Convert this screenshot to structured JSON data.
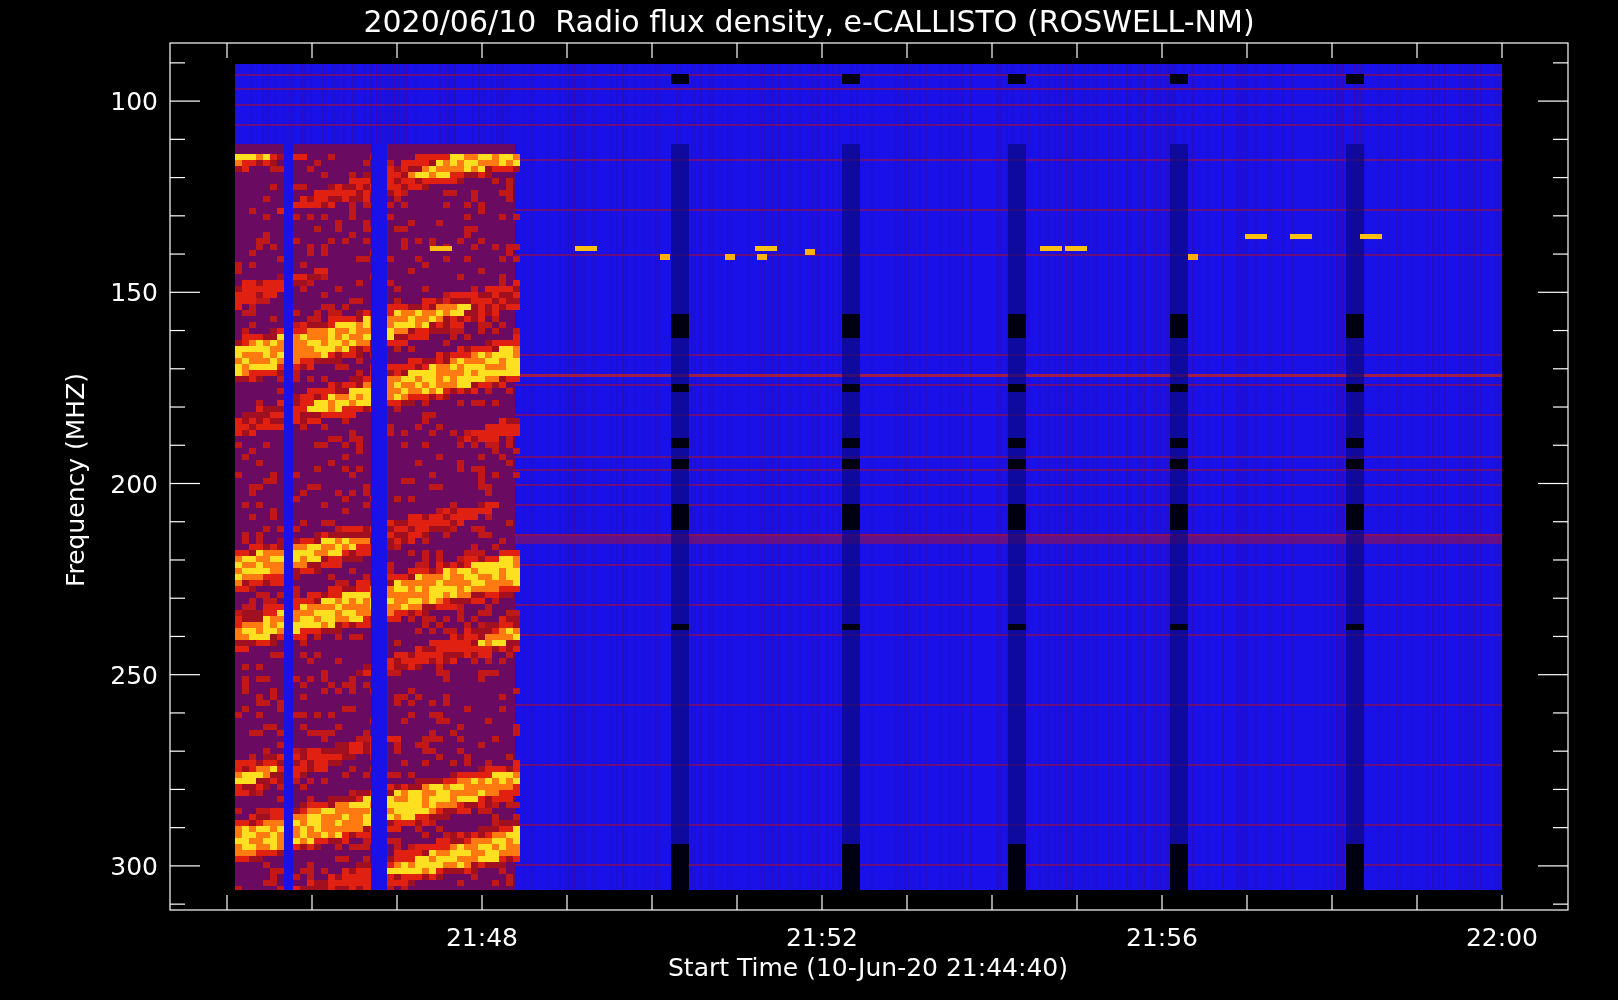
{
  "title": "2020/06/10  Radio flux density, e-CALLISTO (ROSWELL-NM)",
  "chart": {
    "ylabel": "Frequency (MHZ)",
    "xlabel": "Start Time (10-Jun-20 21:44:40)",
    "yticks": [
      "100",
      "150",
      "200",
      "250",
      "300"
    ],
    "xticks": [
      "21:48",
      "21:52",
      "21:56",
      "22:00"
    ]
  }
}
